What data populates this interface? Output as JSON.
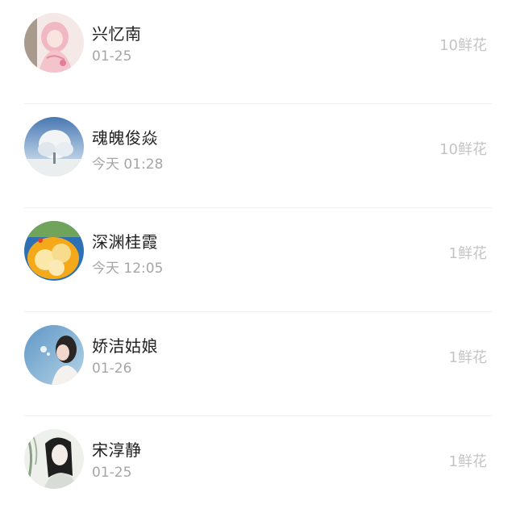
{
  "items": [
    {
      "name": "兴忆南",
      "time": "01-25",
      "flowers": "10鲜花",
      "avatar_icon": "pink-anime-girl-avatar"
    },
    {
      "name": "魂魄俊焱",
      "time": "今天 01:28",
      "flowers": "10鲜花",
      "avatar_icon": "snowy-tree-avatar"
    },
    {
      "name": "深渊桂霞",
      "time": "今天 12:05",
      "flowers": "1鲜花",
      "avatar_icon": "orange-sweets-avatar"
    },
    {
      "name": "娇洁姑娘",
      "time": "01-26",
      "flowers": "1鲜花",
      "avatar_icon": "girl-portrait-avatar"
    },
    {
      "name": "宋淳静",
      "time": "01-25",
      "flowers": "1鲜花",
      "avatar_icon": "ink-drawing-man-avatar"
    }
  ]
}
